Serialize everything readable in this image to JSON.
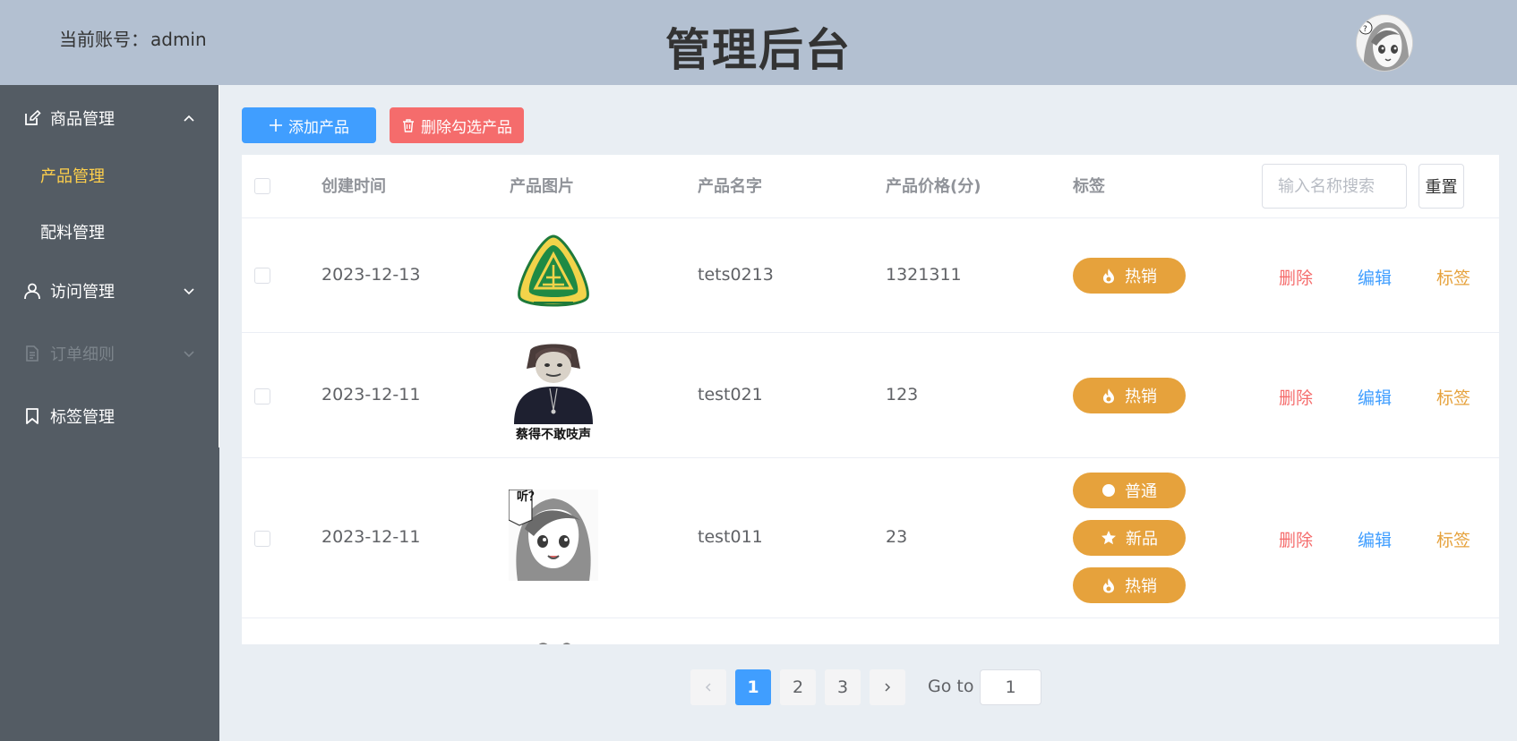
{
  "header": {
    "account_label": "当前账号：",
    "account_name": "admin",
    "title": "管理后台"
  },
  "sidebar": {
    "items": [
      {
        "label": "商品管理",
        "icon": "edit-icon",
        "expanded": true
      },
      {
        "label": "产品管理",
        "active": true
      },
      {
        "label": "配料管理"
      },
      {
        "label": "访问管理",
        "icon": "user-icon",
        "expanded": false
      },
      {
        "label": "订单细则",
        "icon": "document-icon",
        "disabled": true
      },
      {
        "label": "标签管理",
        "icon": "bookmark-icon"
      }
    ]
  },
  "toolbar": {
    "add_label": "添加产品",
    "delete_label": "删除勾选产品"
  },
  "table": {
    "columns": [
      "创建时间",
      "产品图片",
      "产品名字",
      "产品价格(分)",
      "标签"
    ],
    "search_placeholder": "输入名称搜索",
    "reset_label": "重置",
    "rows": [
      {
        "date": "2023-12-13",
        "name": "tets0213",
        "price": "1321311",
        "tags": [
          "热销"
        ]
      },
      {
        "date": "2023-12-11",
        "name": "test021",
        "price": "123",
        "tags": [
          "热销"
        ],
        "image_caption": "蔡得不敢吱声"
      },
      {
        "date": "2023-12-11",
        "name": "test011",
        "price": "23",
        "tags": [
          "普通",
          "新品",
          "热销"
        ],
        "image_caption": "听？"
      }
    ],
    "actions": {
      "delete": "删除",
      "edit": "编辑",
      "tag": "标签"
    }
  },
  "pagination": {
    "pages": [
      "1",
      "2",
      "3"
    ],
    "current": "1",
    "goto_label": "Go to",
    "goto_value": "1"
  },
  "colors": {
    "header_bg": "#b3c0d1",
    "sidebar_bg": "#545c64",
    "active_menu": "#ffd04b",
    "primary": "#409eff",
    "danger": "#f56c6c",
    "warning": "#e6a23c"
  }
}
